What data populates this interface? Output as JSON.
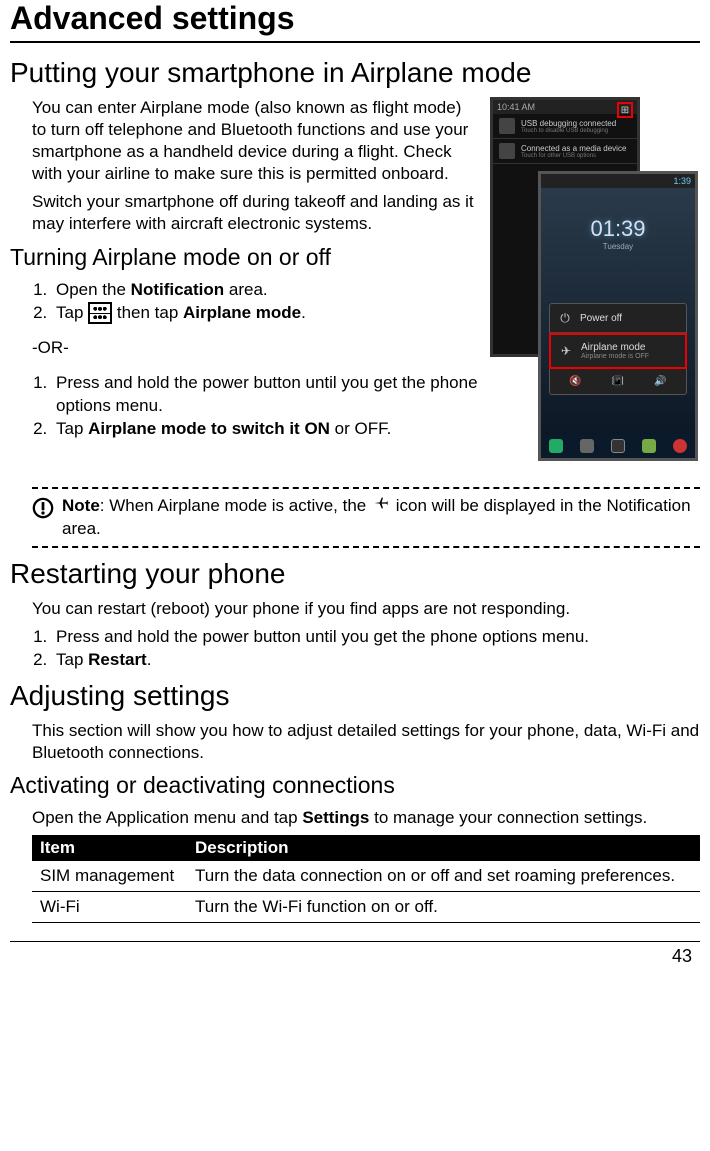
{
  "page": {
    "title": "Advanced settings",
    "number": "43"
  },
  "airplane": {
    "heading": "Putting your smartphone in Airplane mode",
    "para1": "You can enter Airplane mode (also known as flight mode) to turn off telephone and Bluetooth functions and use your smartphone as a handheld device during a flight. Check with your airline to make sure this is permitted onboard.",
    "para2": "Switch your smartphone off during takeoff and landing as it may interfere with aircraft electronic systems.",
    "sub_heading": "Turning Airplane mode on or off",
    "list_a": {
      "item1_pre": "Open the ",
      "item1_bold": "Notification",
      "item1_post": " area.",
      "item2_pre": "Tap ",
      "item2_mid": " then tap ",
      "item2_bold2": "Airplane mode",
      "item2_post": "."
    },
    "or": "-OR-",
    "list_b": {
      "item1": "Press and hold the power button until you get the phone options menu.",
      "item2_pre": "Tap ",
      "item2_bold": "Airplane mode to switch it ON",
      "item2_post": " or OFF."
    },
    "note_pre": "Note",
    "note_mid": ": When Airplane mode is active, the ",
    "note_post": " icon will be displayed in the Notification area."
  },
  "restart": {
    "heading": "Restarting your phone",
    "para": "You can restart (reboot) your phone if you find apps are not responding.",
    "item1": "Press and hold the power button until you get the phone options menu.",
    "item2_pre": "Tap ",
    "item2_bold": "Restart",
    "item2_post": "."
  },
  "adjust": {
    "heading": "Adjusting settings",
    "para": "This section will show you how to adjust detailed settings for your phone, data, Wi-Fi and Bluetooth connections.",
    "sub_heading": "Activating or deactivating connections",
    "para2_pre": "Open the Application menu and tap ",
    "para2_bold": "Settings",
    "para2_post": " to manage your connection settings."
  },
  "table": {
    "h1": "Item",
    "h2": "Description",
    "rows": [
      {
        "item": "SIM management",
        "desc": "Turn the data connection on or off and set roaming preferences."
      },
      {
        "item": "Wi-Fi",
        "desc": "Turn the Wi-Fi function on or off."
      }
    ]
  },
  "screenshots": {
    "phone1": {
      "time": "10:41 AM",
      "row1_title": "USB debugging connected",
      "row1_sub": "Touch to disable USB debugging",
      "row2_title": "Connected as a media device",
      "row2_sub": "Touch for other USB options"
    },
    "phone2": {
      "time": "1:39",
      "clock": "01:39",
      "date": "Tuesday",
      "opt1": "Power off",
      "opt2": "Airplane mode",
      "opt2_sub": "Airplane mode is OFF"
    }
  }
}
